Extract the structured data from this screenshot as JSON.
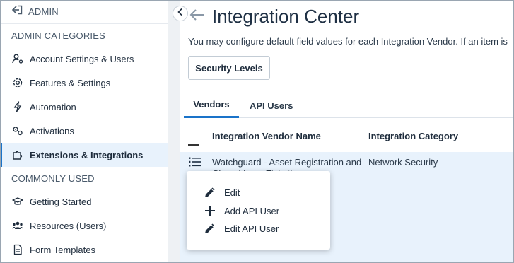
{
  "sidebar": {
    "admin_label": "ADMIN",
    "categories_header": "ADMIN CATEGORIES",
    "categories": [
      {
        "label": "Account Settings & Users",
        "icon": "user-gear-icon"
      },
      {
        "label": "Features & Settings",
        "icon": "gear-icon"
      },
      {
        "label": "Automation",
        "icon": "lightning-icon"
      },
      {
        "label": "Activations",
        "icon": "activations-gears-icon"
      },
      {
        "label": "Extensions & Integrations",
        "icon": "puzzle-icon",
        "active": true
      }
    ],
    "common_header": "COMMONLY USED",
    "common": [
      {
        "label": "Getting Started",
        "icon": "graduation-cap-icon"
      },
      {
        "label": "Resources (Users)",
        "icon": "users-icon"
      },
      {
        "label": "Form Templates",
        "icon": "document-icon"
      }
    ]
  },
  "header": {
    "title": "Integration Center",
    "description": "You may configure default field values for each Integration Vendor. If an item is"
  },
  "toolbar": {
    "security_levels_label": "Security Levels"
  },
  "tabs": [
    {
      "label": "Vendors",
      "active": true
    },
    {
      "label": "API Users",
      "active": false
    }
  ],
  "table": {
    "columns": [
      "Integration Vendor Name",
      "Integration Category"
    ],
    "rows": [
      {
        "vendor": "Watchguard - Asset Registration and Closed Loop Ticketing",
        "category": "Network Security"
      }
    ]
  },
  "context_menu": {
    "items": [
      {
        "label": "Edit",
        "icon": "pencil-icon"
      },
      {
        "label": "Add API User",
        "icon": "plus-icon"
      },
      {
        "label": "Edit API User",
        "icon": "pencil-icon"
      }
    ]
  },
  "colors": {
    "accent": "#1a73c9",
    "active_bg": "#e8f2fc"
  }
}
